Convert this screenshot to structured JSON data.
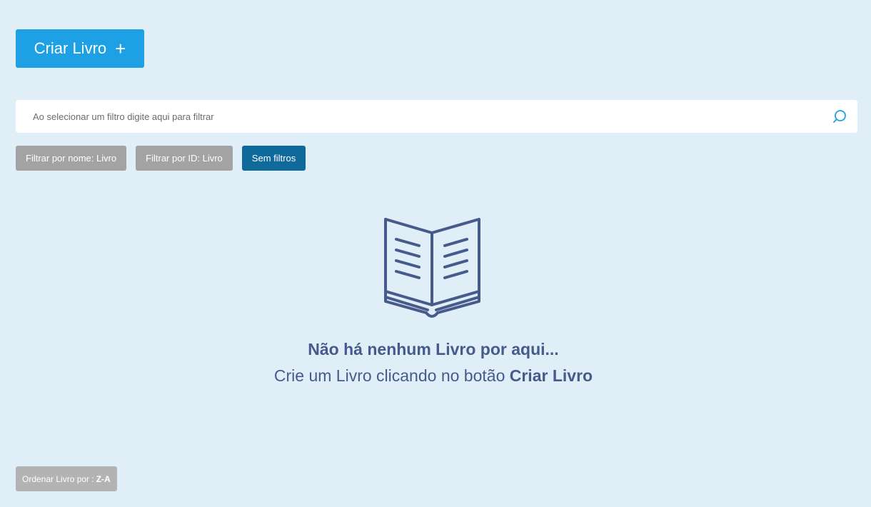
{
  "toolbar": {
    "create_label": "Criar Livro",
    "create_icon": "plus-icon"
  },
  "search": {
    "placeholder": "Ao selecionar um filtro digite aqui para filtrar",
    "value": "",
    "icon": "search-icon"
  },
  "filters": [
    {
      "label": "Filtrar por nome: Livro",
      "active": false
    },
    {
      "label": "Filtrar por ID: Livro",
      "active": false
    },
    {
      "label": "Sem filtros",
      "active": true
    }
  ],
  "empty_state": {
    "icon": "open-book-icon",
    "title": "Não há nenhum Livro por aqui...",
    "subtitle_prefix": "Crie um Livro clicando no botão",
    "subtitle_emphasis": "Criar Livro"
  },
  "sort": {
    "label": "Ordenar Livro por :",
    "value": "Z-A"
  },
  "colors": {
    "background": "#e0eff7",
    "primary": "#1ea0e5",
    "active_filter": "#0f6a9b",
    "inactive_filter": "#a3a3a3",
    "text_accent": "#465a8c"
  }
}
